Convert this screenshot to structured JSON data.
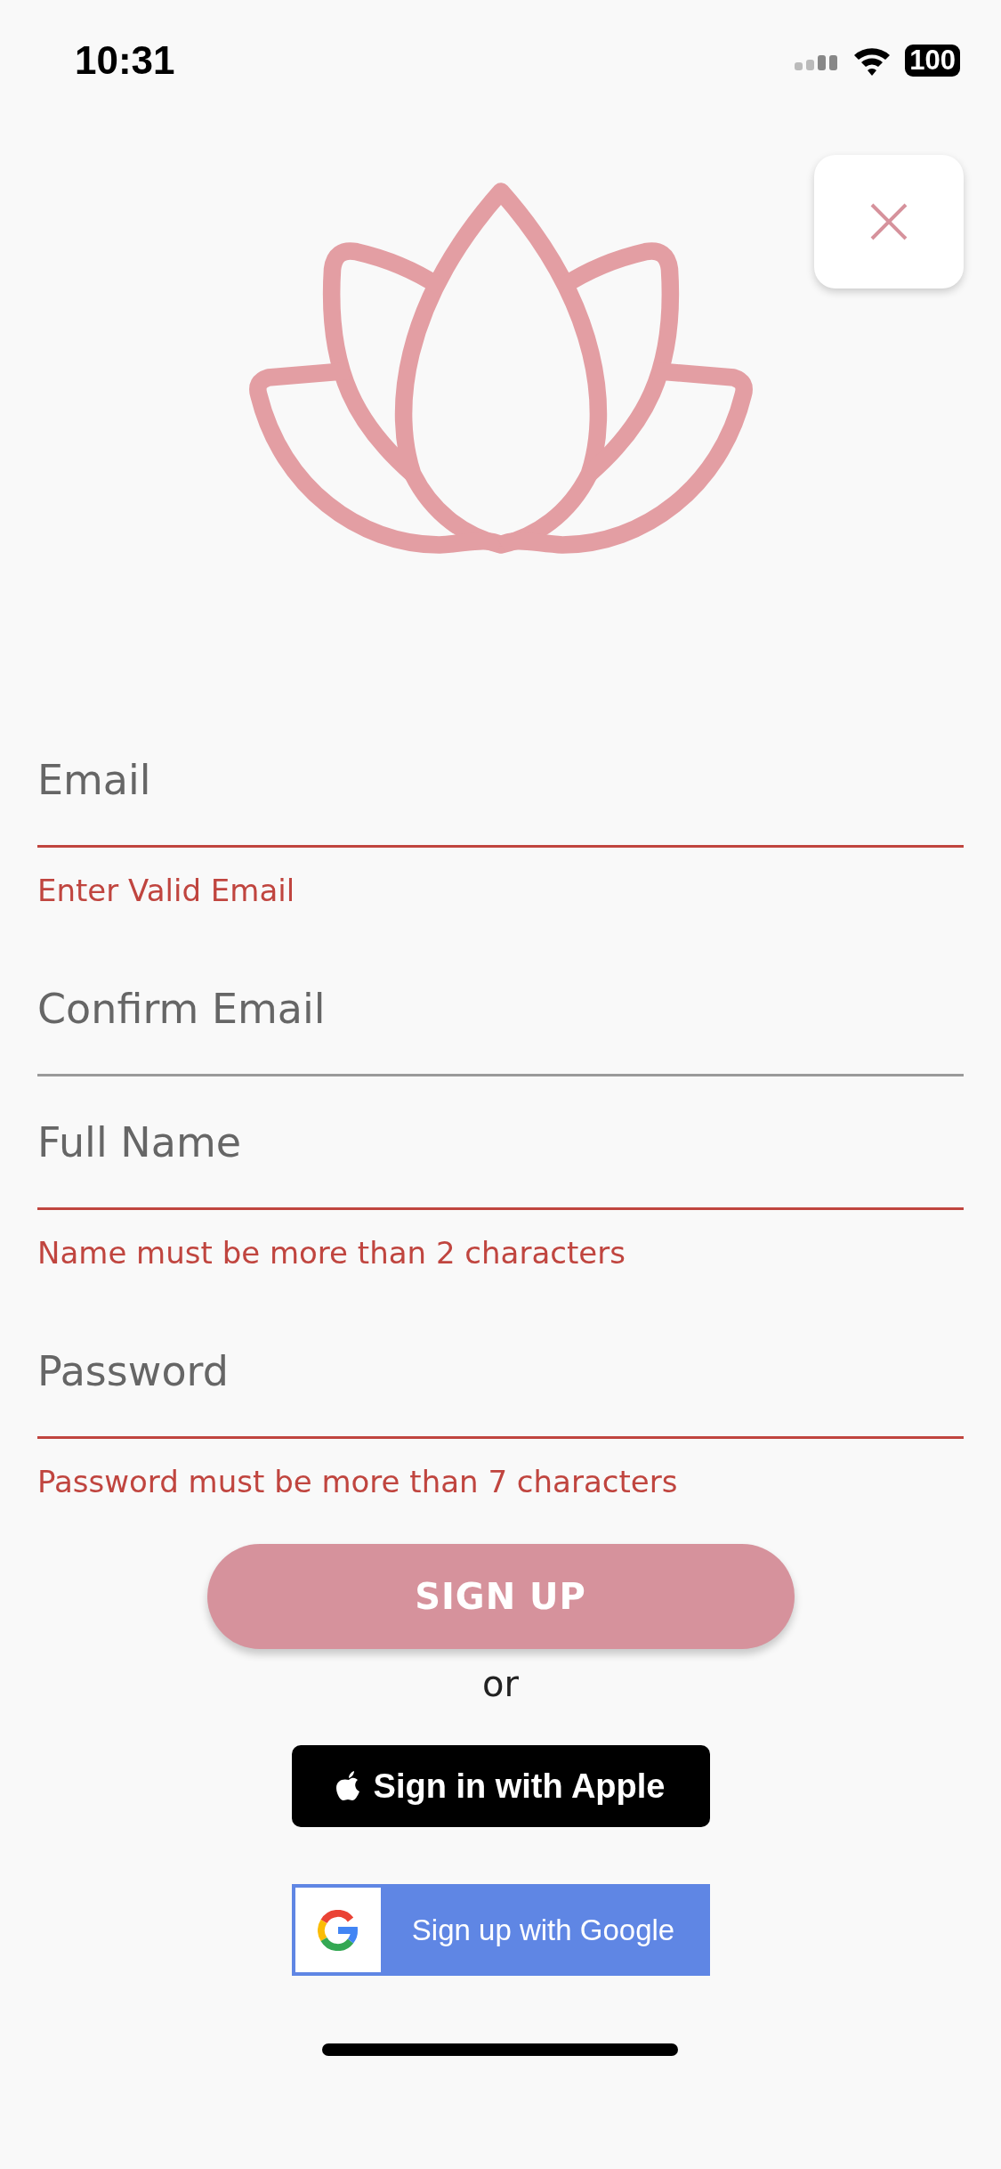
{
  "status_bar": {
    "time": "10:31",
    "battery": "100"
  },
  "fields": [
    {
      "placeholder": "Email",
      "invalid": true,
      "error": "Enter Valid Email"
    },
    {
      "placeholder": "Confirm Email",
      "invalid": false
    },
    {
      "placeholder": "Full Name",
      "invalid": true,
      "error": "Name must be more than 2 characters"
    },
    {
      "placeholder": "Password",
      "invalid": true,
      "error": "Password must be more than 7 characters"
    }
  ],
  "primary_button": "SIGN UP",
  "separator": "or",
  "apple_button": "Sign in with Apple",
  "google_button": "Sign up with Google"
}
